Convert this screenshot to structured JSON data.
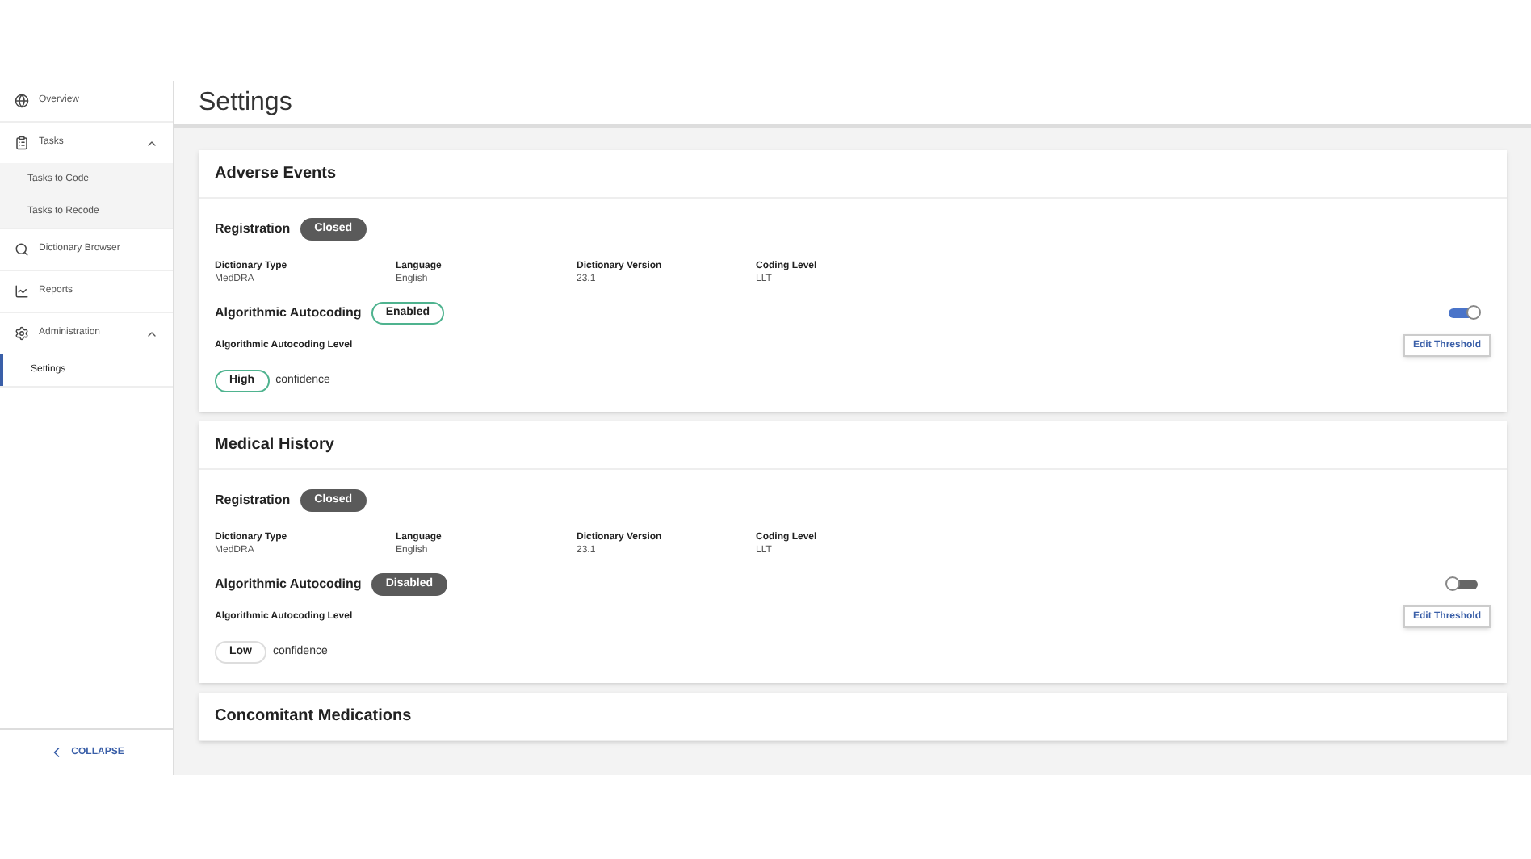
{
  "sidebar": {
    "items": [
      {
        "label": "Overview",
        "kind": "globe",
        "selected": false
      },
      {
        "label": "Tasks",
        "kind": "list",
        "expanded": true,
        "selected": false,
        "children": [
          {
            "label": "Tasks to Code",
            "selected": false
          },
          {
            "label": "Tasks to Recode",
            "selected": false
          }
        ]
      },
      {
        "label": "Dictionary Browser",
        "kind": "search",
        "selected": false
      },
      {
        "label": "Reports",
        "kind": "chart",
        "selected": false
      },
      {
        "label": "Administration",
        "kind": "gear",
        "expanded": true,
        "selected": false,
        "children": [
          {
            "label": "Settings",
            "selected": true
          }
        ]
      }
    ],
    "collapse": "COLLAPSE"
  },
  "page_title": "Settings",
  "sections": [
    {
      "title": "Adverse Events",
      "registration": {
        "label": "Registration",
        "status": "Closed",
        "kind": "dark"
      },
      "fields": [
        {
          "label": "Dictionary Type",
          "value": "MedDRA"
        },
        {
          "label": "Language",
          "value": "English"
        },
        {
          "label": "Dictionary Version",
          "value": "23.1"
        },
        {
          "label": "Coding Level",
          "value": "LLT"
        }
      ],
      "autocoding": {
        "label": "Algorithmic Autocoding",
        "status": "Enabled",
        "kind": "outline",
        "on": true
      },
      "level_label": "Algorithmic Autocoding Level",
      "confidence": {
        "level": "High",
        "kind": "outline",
        "text": "confidence"
      },
      "button": "Edit Threshold"
    },
    {
      "title": "Medical History",
      "registration": {
        "label": "Registration",
        "status": "Closed",
        "kind": "dark"
      },
      "fields": [
        {
          "label": "Dictionary Type",
          "value": "MedDRA"
        },
        {
          "label": "Language",
          "value": "English"
        },
        {
          "label": "Dictionary Version",
          "value": "23.1"
        },
        {
          "label": "Coding Level",
          "value": "LLT"
        }
      ],
      "autocoding": {
        "label": "Algorithmic Autocoding",
        "status": "Disabled",
        "kind": "dark",
        "on": false
      },
      "level_label": "Algorithmic Autocoding Level",
      "confidence": {
        "level": "Low",
        "kind": "plain",
        "text": "confidence"
      },
      "button": "Edit Threshold"
    },
    {
      "title": "Concomitant Medications"
    }
  ]
}
